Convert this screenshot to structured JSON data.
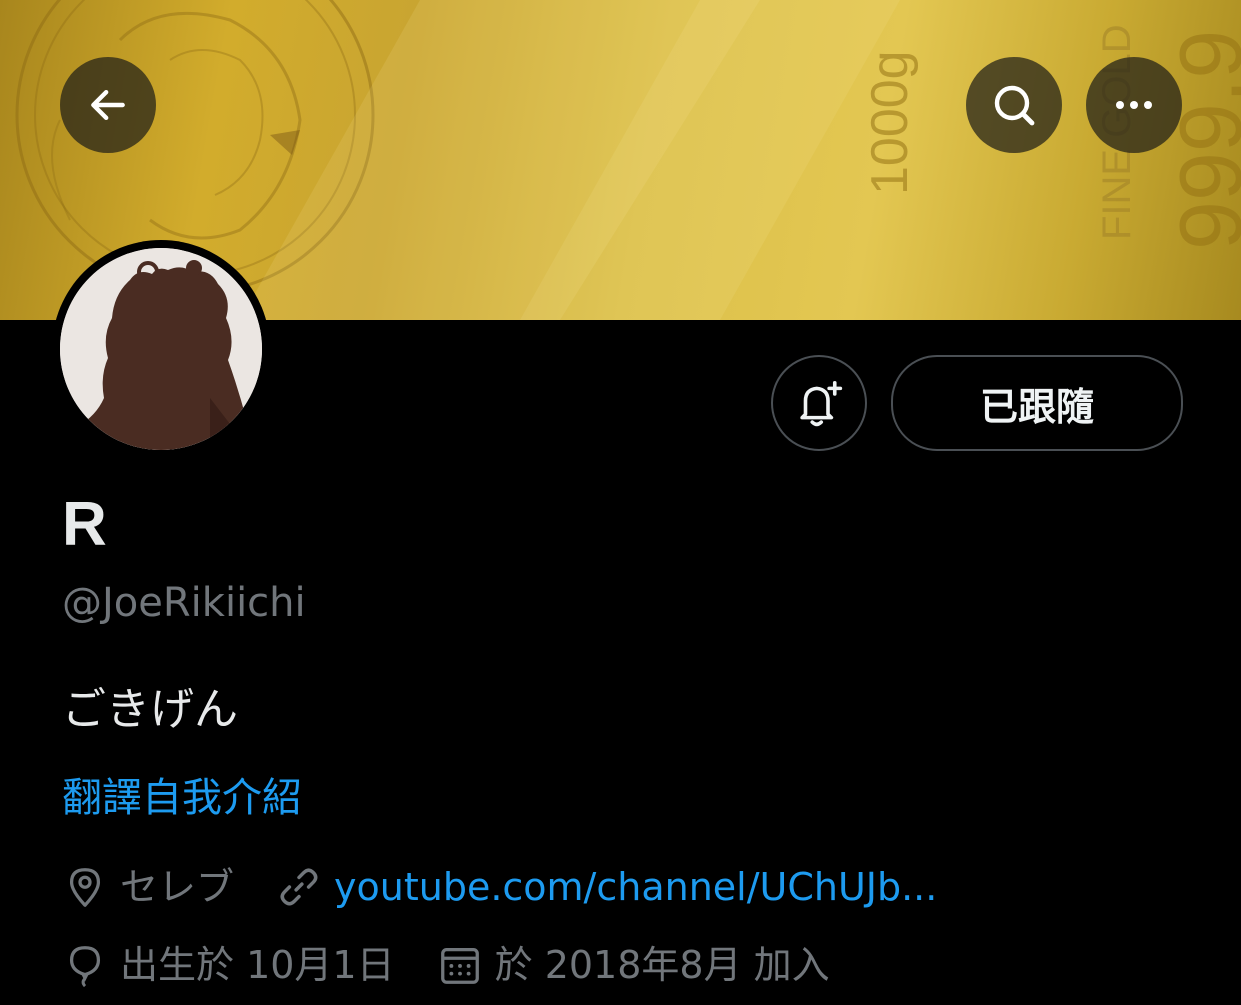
{
  "banner": {
    "stamp_weight": "1000g",
    "stamp_fine": "FINE GOLD",
    "stamp_purity": "999.9"
  },
  "header": {
    "back_icon": "arrow-left-icon",
    "search_icon": "search-icon",
    "more_icon": "more-horizontal-icon"
  },
  "actions": {
    "notification_icon": "bell-plus-icon",
    "follow_label": "已跟隨"
  },
  "profile": {
    "display_name": "R",
    "handle": "@JoeRikiichi",
    "bio": "ごきげん",
    "translate_label": "翻譯自我介紹",
    "location": "セレブ",
    "website": "youtube.com/channel/UChUJb...",
    "birthday": "出生於 10月1日",
    "joined": "於 2018年8月 加入"
  },
  "colors": {
    "background": "#000000",
    "primary_text": "#e7e9ea",
    "secondary_text": "#71767b",
    "accent": "#1d9bf0",
    "border": "#4a4f54"
  }
}
